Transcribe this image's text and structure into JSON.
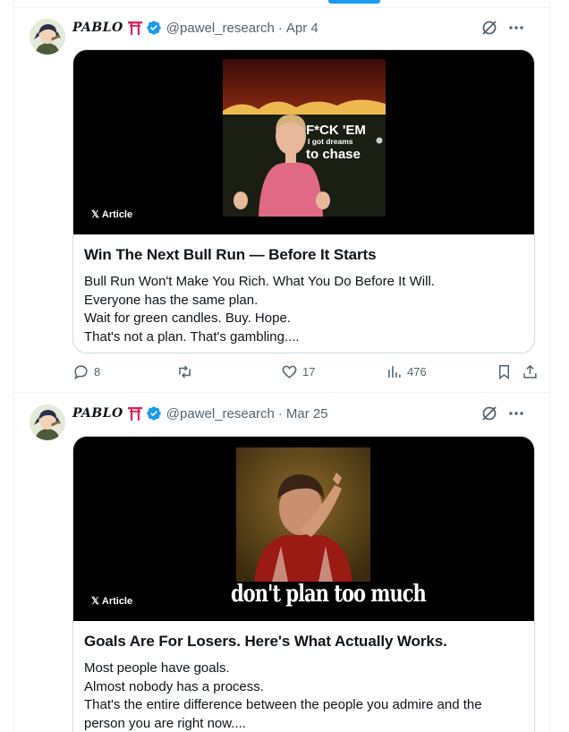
{
  "tweets": [
    {
      "author": {
        "display_name": "PABLO",
        "emoji_icon": "torii-gate-icon",
        "verified": true,
        "handle": "@pawel_research",
        "date": "Apr 4"
      },
      "article": {
        "badge": "Article",
        "image_caption_big": "F*CK 'EM",
        "image_caption_small": "I got dreams",
        "image_caption_big2": "to chase",
        "title": "Win The Next Bull Run — Before It Starts",
        "lines": [
          "Bull Run Won't Make You Rich. What You Do Before It Will.",
          "Everyone has the same plan.",
          "Wait for green candles. Buy. Hope.",
          "That's not a plan. That's gambling...."
        ]
      },
      "actions": {
        "replies": "8",
        "retweets": "",
        "likes": "17",
        "views": "476"
      }
    },
    {
      "author": {
        "display_name": "PABLO",
        "emoji_icon": "torii-gate-icon",
        "verified": true,
        "handle": "@pawel_research",
        "date": "Mar 25"
      },
      "article": {
        "badge": "Article",
        "image_caption": "don't plan too much",
        "title": "Goals Are For Losers. Here's What Actually Works.",
        "lines": [
          "Most people have goals.",
          "Almost nobody has a process.",
          "That's the entire difference between the people you admire and the",
          "person you are right now...."
        ]
      }
    }
  ],
  "colors": {
    "accent": "#1d9bf0",
    "text": "#0f1419",
    "muted": "#536471",
    "border": "#cfd9de",
    "torii": "#e0245e"
  }
}
